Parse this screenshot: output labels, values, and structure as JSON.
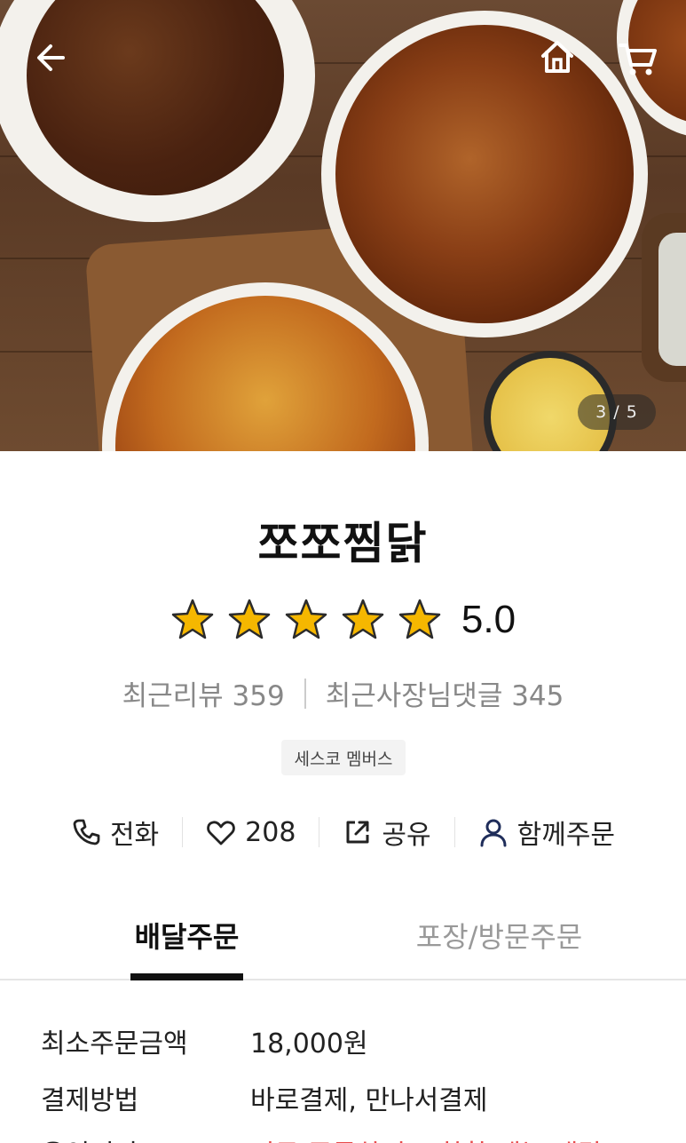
{
  "header": {
    "back_icon": "arrow-left-icon",
    "home_icon": "home-icon",
    "cart_icon": "cart-icon"
  },
  "hero": {
    "counter": "3 / 5"
  },
  "store": {
    "name": "쪼쪼찜닭",
    "rating": "5.0",
    "stars": 5,
    "recent_reviews": "최근리뷰 359",
    "recent_owner_replies": "최근사장님댓글 345",
    "badge": "세스코 멤버스"
  },
  "actions": {
    "call": "전화",
    "likes": "208",
    "share": "공유",
    "group_order": "함께주문"
  },
  "tabs": {
    "delivery": "배달주문",
    "pickup": "포장/방문주문"
  },
  "info": {
    "min_order_label": "최소주문금액",
    "min_order_value": "18,000원",
    "payment_label": "결제방법",
    "payment_value": "바로결제, 만나서결제",
    "partial_label": "운영시간",
    "partial_value": "지금 주문하면 도착할 때는 배달"
  },
  "colors": {
    "accent_red": "#e84a4a",
    "star_fill": "#f5b700"
  }
}
